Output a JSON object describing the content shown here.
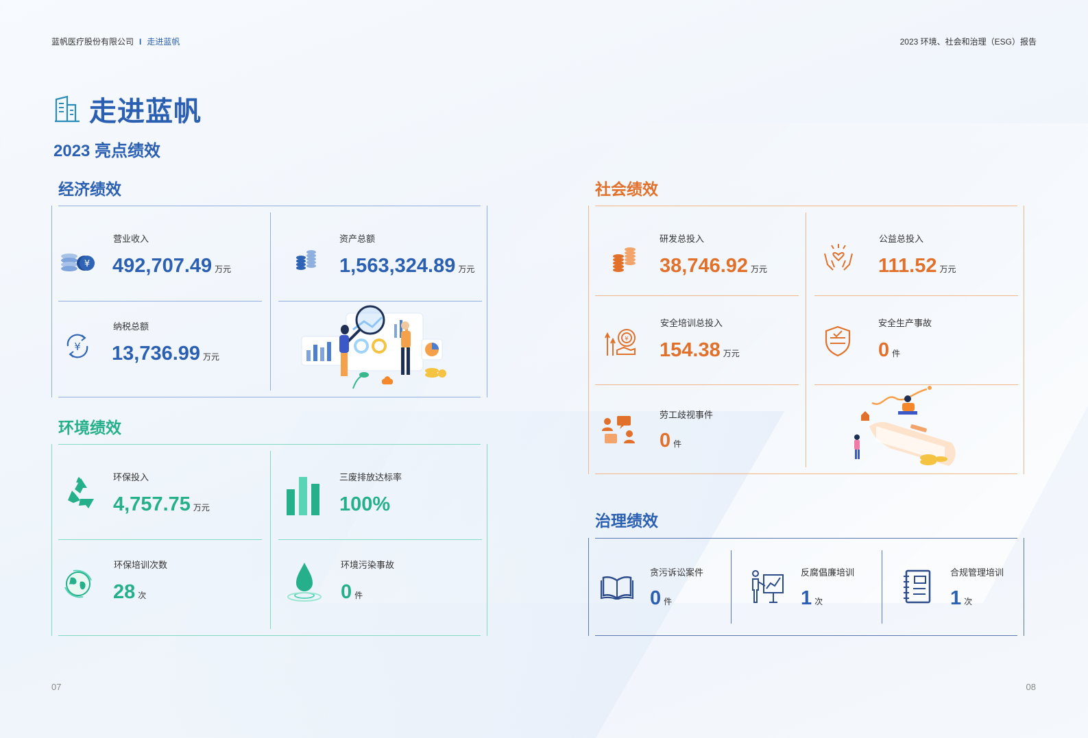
{
  "header": {
    "company": "蓝帆医疗股份有限公司",
    "separator": "I",
    "section": "走进蓝帆",
    "report": "2023 环境、社会和治理（ESG）报告"
  },
  "page_title": "走进蓝帆",
  "subtitle": "2023 亮点绩效",
  "economic": {
    "title": "经济绩效",
    "items": [
      {
        "label": "营业收入",
        "value": "492,707.49",
        "unit": "万元",
        "icon": "coins-yuan-icon"
      },
      {
        "label": "资产总额",
        "value": "1,563,324.89",
        "unit": "万元",
        "icon": "coin-stacks-icon"
      },
      {
        "label": "纳税总额",
        "value": "13,736.99",
        "unit": "万元",
        "icon": "yuan-cycle-icon"
      }
    ]
  },
  "environment": {
    "title": "环境绩效",
    "items": [
      {
        "label": "环保投入",
        "value": "4,757.75",
        "unit": "万元",
        "icon": "recycle-icon"
      },
      {
        "label": "三废排放达标率",
        "value": "100%",
        "unit": "",
        "icon": "bar-chart-icon"
      },
      {
        "label": "环保培训次数",
        "value": "28",
        "unit": "次",
        "icon": "globe-icon"
      },
      {
        "label": "环境污染事故",
        "value": "0",
        "unit": "件",
        "icon": "water-drop-icon"
      }
    ]
  },
  "social": {
    "title": "社会绩效",
    "items": [
      {
        "label": "研发总投入",
        "value": "38,746.92",
        "unit": "万元",
        "icon": "coin-stacks-icon"
      },
      {
        "label": "公益总投入",
        "value": "111.52",
        "unit": "万元",
        "icon": "hands-heart-icon"
      },
      {
        "label": "安全培训总投入",
        "value": "154.38",
        "unit": "万元",
        "icon": "training-investment-icon"
      },
      {
        "label": "安全生产事故",
        "value": "0",
        "unit": "件",
        "icon": "shield-check-icon"
      },
      {
        "label": "劳工歧视事件",
        "value": "0",
        "unit": "件",
        "icon": "people-chat-icon"
      }
    ]
  },
  "governance": {
    "title": "治理绩效",
    "items": [
      {
        "label": "贪污诉讼案件",
        "value": "0",
        "unit": "件",
        "icon": "open-book-icon"
      },
      {
        "label": "反腐倡廉培训",
        "value": "1",
        "unit": "次",
        "icon": "presenter-board-icon"
      },
      {
        "label": "合规管理培训",
        "value": "1",
        "unit": "次",
        "icon": "notebook-icon"
      }
    ]
  },
  "colors": {
    "blue": "#2a5fb2",
    "green": "#25b08b",
    "orange": "#e0702a",
    "governance_line": "#5a78b0"
  },
  "page_numbers": {
    "left": "07",
    "right": "08"
  }
}
